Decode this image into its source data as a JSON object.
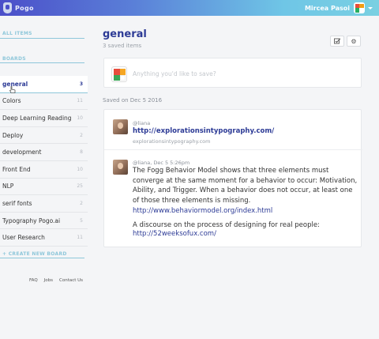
{
  "app": {
    "logo_text": "Pogo",
    "user_name": "Mircea Pasoi"
  },
  "sidebar": {
    "all_items_label": "ALL ITEMS",
    "boards_label": "BOARDS",
    "boards": [
      {
        "label": "general",
        "count": "3",
        "active": true
      },
      {
        "label": "Colors",
        "count": "11"
      },
      {
        "label": "Deep Learning Reading",
        "count": "10"
      },
      {
        "label": "Deploy",
        "count": "2"
      },
      {
        "label": "development",
        "count": "8"
      },
      {
        "label": "Front End",
        "count": "10"
      },
      {
        "label": "NLP",
        "count": "25"
      },
      {
        "label": "serif fonts",
        "count": "2"
      },
      {
        "label": "Typography Pogo.ai",
        "count": "5"
      },
      {
        "label": "User Research",
        "count": "11"
      }
    ],
    "create_board_label": "+ CREATE NEW BOARD",
    "footer": [
      "FAQ",
      "Jobs",
      "Contact Us"
    ]
  },
  "main": {
    "title": "general",
    "saved_count": "3 saved items",
    "compose_placeholder": "Anything you'd like to save?",
    "date_heading": "Saved on Dec 5 2016",
    "posts": [
      {
        "meta": "@liana",
        "link": "http://explorationsintypography.com/",
        "domain": "explorationsintypography.com"
      },
      {
        "meta": "@liana, Dec 5 5:26pm",
        "body": "The Fogg Behavior Model shows that three elements must converge at the same moment for a behavior to occur: Motivation, Ability, and Trigger. When a behavior does not occur, at least one of those three elements is missing.",
        "link": "http://www.behaviormodel.org/index.html",
        "body2": "A discourse on the process of designing for real people:",
        "link2": "http://52weeksofux.com/"
      }
    ]
  },
  "colors": {
    "brand": "#2d3b96",
    "accent": "#8ec7da",
    "topbar_start": "#4b4fc9",
    "topbar_end": "#7ad0e2"
  }
}
